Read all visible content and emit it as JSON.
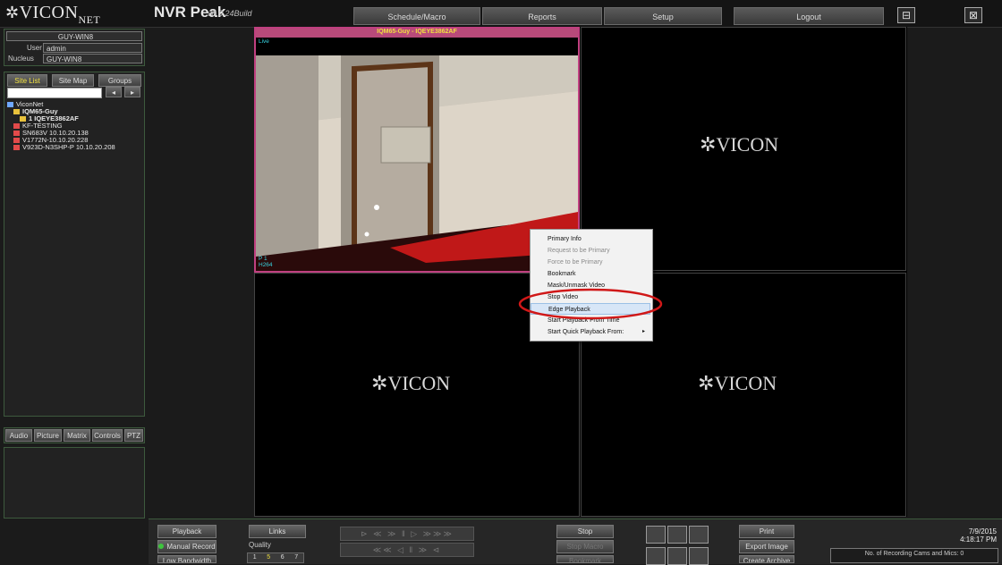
{
  "app": {
    "logo_text": "VICON",
    "logo_sub": "NET",
    "product": "NVR Peak",
    "version": "v8.0.24Build"
  },
  "top_menu": {
    "schedule": "Schedule/Macro",
    "reports": "Reports",
    "setup": "Setup",
    "logout": "Logout",
    "minimize": "⊟",
    "close": "⊠"
  },
  "session": {
    "host": "GUY-WIN8",
    "user_label": "User",
    "user_value": "admin",
    "nucleus_label": "Nucleus",
    "nucleus_value": "GUY-WIN8"
  },
  "site_tabs": [
    "Site List",
    "Site Map",
    "Groups"
  ],
  "site_search": {
    "value": "",
    "prev": "◂",
    "next": "▸"
  },
  "tree": [
    {
      "label": "ViconNet",
      "indent": 0,
      "icon": "network-icon",
      "color": "#6fa8ff"
    },
    {
      "label": "IQM65-Guy",
      "indent": 1,
      "icon": "server-icon",
      "color": "#e8c23c",
      "bold": true
    },
    {
      "label": "1  IQEYE3862AF",
      "indent": 2,
      "icon": "camera-icon",
      "color": "#e8c23c",
      "bold": true
    },
    {
      "label": "KF-TESTING",
      "indent": 1,
      "icon": "server-offline-icon",
      "color": "#e24a4a"
    },
    {
      "label": "SN683V 10.10.20.138",
      "indent": 1,
      "icon": "server-offline-icon",
      "color": "#e24a4a"
    },
    {
      "label": "V1772N-10.10.20.228",
      "indent": 1,
      "icon": "server-offline-icon",
      "color": "#e24a4a"
    },
    {
      "label": "V923D-N3SHP-P 10.10.20.208",
      "indent": 1,
      "icon": "server-offline-icon",
      "color": "#e24a4a"
    }
  ],
  "control_tabs": [
    "Audio",
    "Picture",
    "Matrix",
    "Controls",
    "PTZ"
  ],
  "video": {
    "cell1_title": "IQM65-Guy - IQEYE3862AF",
    "cell1_live": "Live",
    "cell1_p": "P 1",
    "cell1_codec": "H264",
    "brand": "VICON"
  },
  "context_menu": [
    {
      "label": "Primary Info",
      "disabled": false
    },
    {
      "label": "Request to be Primary",
      "disabled": true
    },
    {
      "label": "Force to be Primary",
      "disabled": true
    },
    {
      "label": "Bookmark",
      "disabled": false
    },
    {
      "label": "Mask/Unmask Video",
      "disabled": false
    },
    {
      "label": "Stop Video",
      "disabled": false
    },
    {
      "label": "Edge Playback",
      "disabled": false,
      "highlighted": true
    },
    {
      "label": "Start Playback From Time",
      "disabled": false
    },
    {
      "label": "Start Quick Playback From:",
      "disabled": false,
      "submenu": true
    }
  ],
  "bottom": {
    "playback": "Playback",
    "manual_record": "Manual Record",
    "low_bandwidth": "Low Bandwidth",
    "links": "Links",
    "quality_label": "Quality",
    "quality_options": [
      "1",
      "5",
      "6",
      "7"
    ],
    "quality_selected": "5",
    "stop": "Stop",
    "stop_macro": "Stop Macro",
    "bookmark": "Bookmark",
    "print": "Print",
    "export_image": "Export Image",
    "create_archive": "Create Archive",
    "date": "7/9/2015",
    "time": "4:18:17 PM",
    "recording_info": "No. of Recording Cams and Mics: 0"
  },
  "colors": {
    "accent_title": "#f0e040",
    "selection_border": "#c04080",
    "circle": "#d01818",
    "live_text": "#37d3e0"
  }
}
